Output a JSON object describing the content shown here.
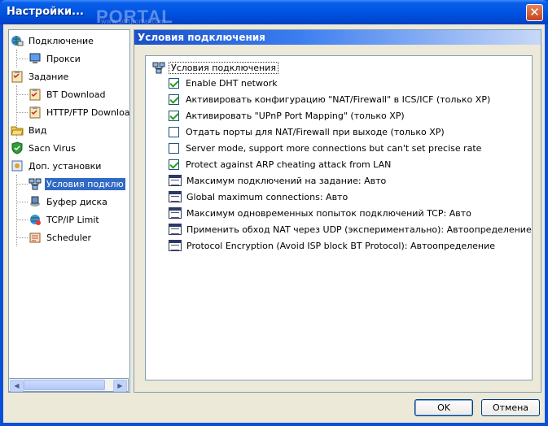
{
  "window": {
    "title": "Настройки...",
    "watermark": "PORTAL",
    "watermark_small": "www.softportal.com"
  },
  "tree": {
    "items": [
      {
        "label": "Подключение",
        "icon": "globe-connection-icon"
      },
      {
        "label": "Прокси",
        "icon": "monitor-icon"
      },
      {
        "label": "Задание",
        "icon": "clipboard-icon"
      },
      {
        "label": "BT Download",
        "icon": "clipboard-check-icon"
      },
      {
        "label": "HTTP/FTP Downloa",
        "icon": "clipboard-check-icon"
      },
      {
        "label": "Вид",
        "icon": "folder-icon"
      },
      {
        "label": "Sacn Virus",
        "icon": "shield-icon"
      },
      {
        "label": "Доп. установки",
        "icon": "settings-icon"
      },
      {
        "label": "Условия подклю",
        "icon": "network-icon"
      },
      {
        "label": "Буфер диска",
        "icon": "disk-icon"
      },
      {
        "label": "TCP/IP Limit",
        "icon": "globe-limit-icon"
      },
      {
        "label": "Scheduler",
        "icon": "scheduler-icon"
      }
    ]
  },
  "panel": {
    "header": "Условия подключения",
    "group": "Условия подключения",
    "options": [
      {
        "label": "Enable DHT network",
        "type": "checkbox",
        "checked": true
      },
      {
        "label": "Активировать конфигурацию \"NAT/Firewall\" в ICS/ICF (только XP)",
        "type": "checkbox",
        "checked": true
      },
      {
        "label": "Активировать \"UPnP Port Mapping\" (только XP)",
        "type": "checkbox",
        "checked": true
      },
      {
        "label": "Отдать порты для NAT/Firewall при выходе (только XP)",
        "type": "checkbox",
        "checked": false
      },
      {
        "label": "Server mode, support more connections but can't set precise rate",
        "type": "checkbox",
        "checked": false
      },
      {
        "label": "Protect against ARP cheating attack from LAN",
        "type": "checkbox",
        "checked": true
      },
      {
        "label": "Максимум подключений на задание: Авто",
        "type": "edit"
      },
      {
        "label": "Global maximum connections: Авто",
        "type": "edit"
      },
      {
        "label": "Максимум одновременных попыток подключений TCP: Авто",
        "type": "edit"
      },
      {
        "label": "Применить обход NAT через UDP (экспериментально): Автоопределение",
        "type": "edit"
      },
      {
        "label": "Protocol Encryption (Avoid ISP block BT Protocol): Автоопределение",
        "type": "edit"
      }
    ]
  },
  "buttons": {
    "ok": "OK",
    "cancel": "Отмена"
  },
  "colors": {
    "title_bar": "#0054e3",
    "selection": "#316ac5",
    "check": "#21a121"
  }
}
